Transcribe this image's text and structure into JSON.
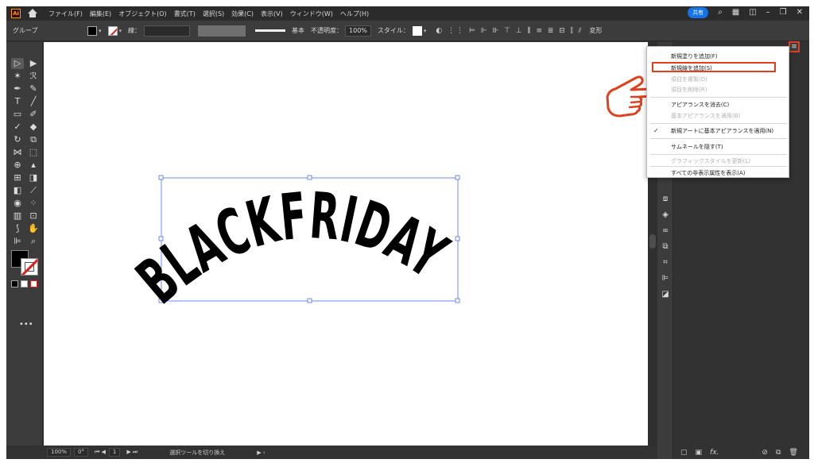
{
  "menubar": {
    "app_icon": "Ai",
    "items": [
      "ファイル(F)",
      "編集(E)",
      "オブジェクト(O)",
      "書式(T)",
      "選択(S)",
      "効果(C)",
      "表示(V)",
      "ウィンドウ(W)",
      "ヘルプ(H)"
    ],
    "share_label": "共有"
  },
  "controlbar": {
    "selection_label": "グループ",
    "stroke_label": "線：",
    "stroke_profile": "基本",
    "opacity_label": "不透明度：",
    "opacity_value": "100%",
    "style_label": "スタイル：",
    "transform_label": "変形"
  },
  "canvas": {
    "artwork_text": "BLACKFRIDAY"
  },
  "statusbar": {
    "zoom": "100%",
    "rotation": "0°",
    "artboard": "1",
    "status_text": "選択ツールを切り換え"
  },
  "flyout": {
    "items": [
      {
        "label": "新規塗りを追加(F)",
        "enabled": true
      },
      {
        "label": "新規線を追加(S)",
        "enabled": true
      },
      {
        "label": "項目を複製(D)",
        "enabled": false
      },
      {
        "label": "項目を削除(R)",
        "enabled": false
      },
      {
        "label": "アピアランスを消去(C)",
        "enabled": true
      },
      {
        "label": "基本アピアランスを適用(B)",
        "enabled": false
      },
      {
        "label": "新規アートに基本アピアランスを適用(N)",
        "enabled": true,
        "checked": true
      },
      {
        "label": "サムネールを隠す(T)",
        "enabled": true
      },
      {
        "label": "グラフィックスタイルを更新(L)",
        "enabled": false
      },
      {
        "label": "すべての非表示属性を表示(A)",
        "enabled": true
      }
    ],
    "highlighted": "新規線を追加(S)"
  },
  "colors": {
    "highlight_border": "#e0401e",
    "share_button": "#1473e6",
    "artwork_fill": "#000000",
    "selection_bbox": "#4a6cf0"
  }
}
